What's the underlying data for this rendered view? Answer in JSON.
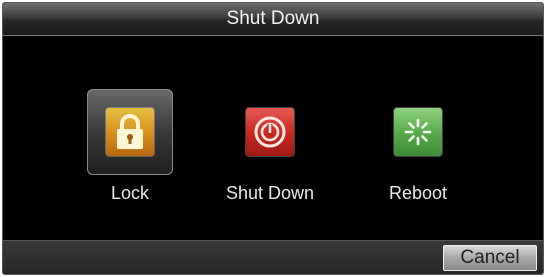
{
  "dialog": {
    "title": "Shut Down"
  },
  "options": [
    {
      "label": "Lock",
      "icon": "lock-icon",
      "color": "#d28a1b",
      "selected": true
    },
    {
      "label": "Shut Down",
      "icon": "power-icon",
      "color": "#c4281f",
      "selected": false
    },
    {
      "label": "Reboot",
      "icon": "reboot-icon",
      "color": "#55a94a",
      "selected": false
    }
  ],
  "footer": {
    "cancel_label": "Cancel"
  }
}
